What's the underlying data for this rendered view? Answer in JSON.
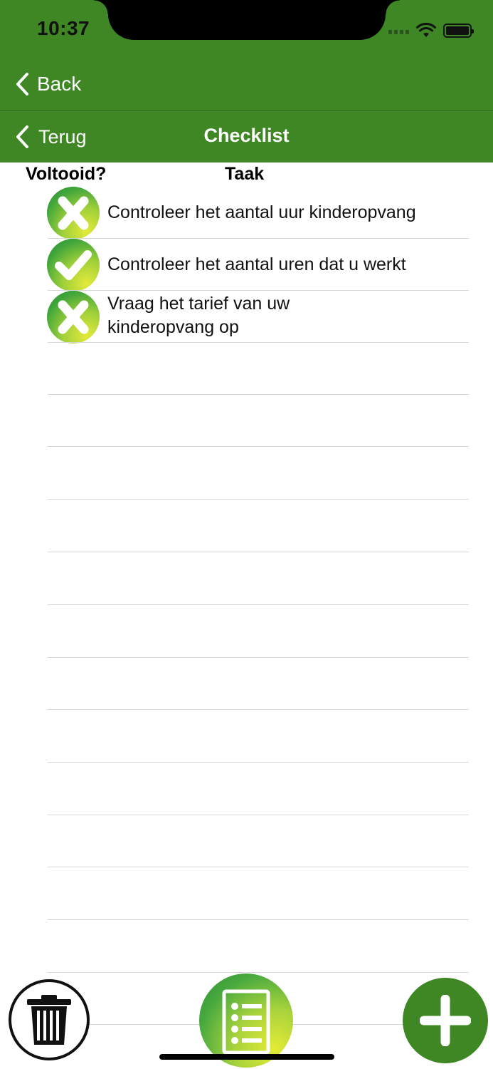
{
  "status_bar": {
    "time": "10:37"
  },
  "nav": {
    "back_label": "Back",
    "terug_label": "Terug",
    "title": "Checklist"
  },
  "columns": {
    "done_header": "Voltooid?",
    "task_header": "Taak"
  },
  "tasks": [
    {
      "label": "Controleer het aantal uur kinderopvang",
      "completed": false
    },
    {
      "label": "Controleer het aantal uren dat u werkt",
      "completed": true
    },
    {
      "label": "Vraag het tarief van uw kinderopvang op",
      "completed": false
    }
  ],
  "colors": {
    "brand_green": "#3f8624",
    "icon_gradient_yellow": "#e3ea3a",
    "icon_gradient_green": "#3ea43b"
  },
  "toolbar": {
    "icons": [
      "trash-icon",
      "checklist-icon",
      "plus-icon"
    ]
  }
}
